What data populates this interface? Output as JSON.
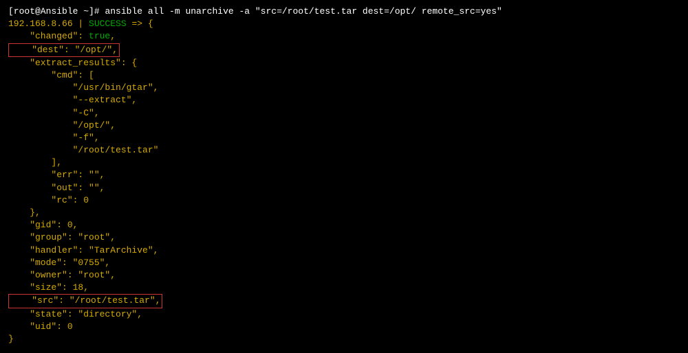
{
  "prompt": {
    "user_host": "[root@Ansible ~]# ",
    "command": "ansible all -m unarchive -a \"src=/root/test.tar dest=/opt/ remote_src=yes\""
  },
  "result_header": {
    "host": "192.168.8.66",
    "separator": " | ",
    "status": "SUCCESS",
    "arrow": " => {"
  },
  "output": {
    "changed_key": "    \"changed\": ",
    "changed_value": "true",
    "changed_comma": ",",
    "dest_line": "    \"dest\": \"/opt/\",",
    "extract_results_open": "    \"extract_results\": {",
    "cmd_open": "        \"cmd\": [",
    "cmd_items": [
      "            \"/usr/bin/gtar\",",
      "            \"--extract\",",
      "            \"-C\",",
      "            \"/opt/\",",
      "            \"-f\",",
      "            \"/root/test.tar\""
    ],
    "cmd_close": "        ],",
    "err_line": "        \"err\": \"\",",
    "out_line": "        \"out\": \"\",",
    "rc_line": "        \"rc\": 0",
    "extract_results_close": "    },",
    "gid_line": "    \"gid\": 0,",
    "group_line": "    \"group\": \"root\",",
    "handler_line": "    \"handler\": \"TarArchive\",",
    "mode_line": "    \"mode\": \"0755\",",
    "owner_line": "    \"owner\": \"root\",",
    "size_line": "    \"size\": 18,",
    "src_line": "    \"src\": \"/root/test.tar\",",
    "state_line": "    \"state\": \"directory\",",
    "uid_line": "    \"uid\": 0",
    "close_brace": "}"
  }
}
